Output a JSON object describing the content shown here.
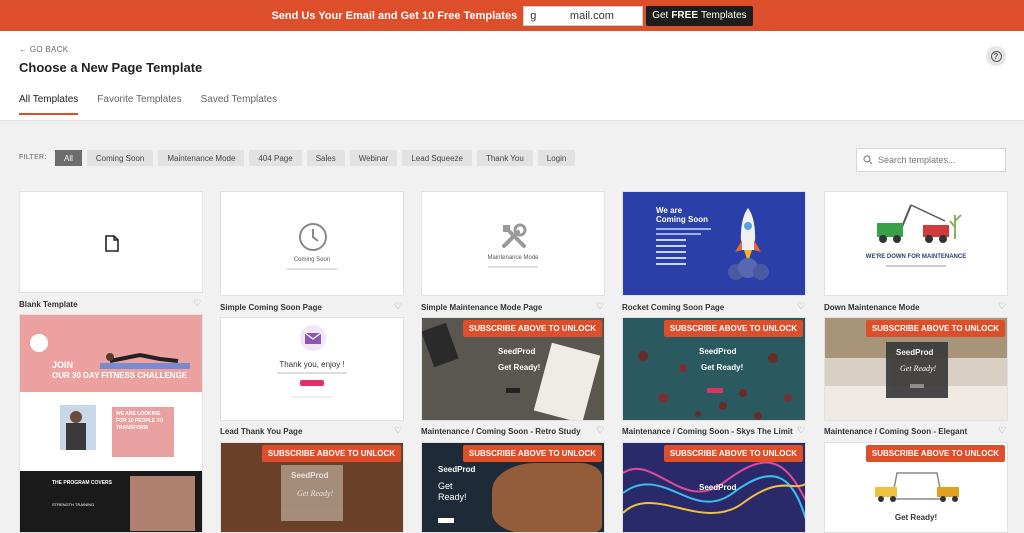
{
  "promo": {
    "text": "Send Us Your Email and Get 10 Free Templates",
    "email_value": "g           mail.com",
    "button_pre": "Get",
    "button_bold": "FREE",
    "button_post": "Templates"
  },
  "header": {
    "back": "← GO BACK",
    "title": "Choose a New Page Template",
    "help_glyph": "?"
  },
  "tabs": [
    "All Templates",
    "Favorite Templates",
    "Saved Templates"
  ],
  "filter": {
    "label": "FILTER:",
    "chips": [
      "All",
      "Coming Soon",
      "Maintenance Mode",
      "404 Page",
      "Sales",
      "Webinar",
      "Lead Squeeze",
      "Thank You",
      "Login"
    ]
  },
  "search": {
    "placeholder": "Search templates..."
  },
  "unlock_label": "SUBSCRIBE ABOVE TO UNLOCK",
  "heart_glyph": "♡",
  "templates": {
    "blank": "Blank Template",
    "simple_coming_soon": "Simple Coming Soon Page",
    "simple_maintenance": "Simple Maintenance Mode Page",
    "rocket_coming_soon": "Rocket Coming Soon Page",
    "down_maintenance": "Down Maintenance Mode",
    "lead_thank_you": "Lead Thank You Page",
    "retro_study": "Maintenance / Coming Soon - Retro Study",
    "skys_limit": "Maintenance / Coming Soon - Skys The Limit",
    "elegant": "Maintenance / Coming Soon - Elegant"
  },
  "previews": {
    "coming_soon": "Coming Soon",
    "maintenance_mode": "Maintenance Mode",
    "rocket_heading_1": "We are",
    "rocket_heading_2": "Coming Soon",
    "down_heading": "WE'RE DOWN FOR MAINTENANCE",
    "thank_you": "Thank you, enjoy !",
    "seedprod": "SeedProd",
    "get_ready": "Get Ready!",
    "get_ready_2": "Get\nReady!",
    "fitness_1": "JOIN",
    "fitness_2": "OUR 30 DAY FITNESS CHALLENGE",
    "fitness_3": "WE ARE LOOKING FOR 10 PEOPLE TO TRANSFORM",
    "fitness_4": "THE PROGRAM COVERS",
    "fitness_5": "STRENGTH TRAINING"
  },
  "colors": {
    "accent": "#dd4e2a",
    "dark_button": "#1d1d1d"
  }
}
